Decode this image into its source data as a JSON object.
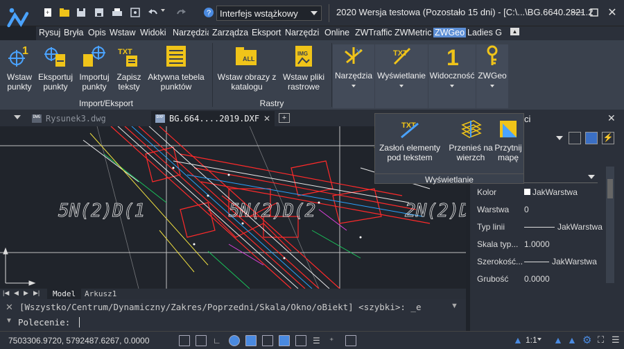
{
  "quick_access": {
    "icons": [
      "new-icon",
      "open-icon",
      "save-icon",
      "save-as-icon",
      "print-icon",
      "plot-preview-icon",
      "undo-icon",
      "redo-icon",
      "help-icon"
    ],
    "workspace": "Interfejs wstążkowy"
  },
  "title": "2020 Wersja testowa (Pozostało 15 dni) - [C:\\...\\BG.6640.2821.2",
  "menu": [
    "Rysuj",
    "Bryła",
    "Opis",
    "Wstaw",
    "Widoki",
    "Narzędzia",
    "Zarządzaj",
    "Eksport",
    "Narzędzia",
    "Online",
    "ZWTraffic",
    "ZWMetric",
    "ZWGeo",
    "Ladies Gr"
  ],
  "menu_active": "ZWGeo",
  "ribbon": {
    "import_export": {
      "label": "Import/Eksport",
      "buttons": [
        {
          "l1": "Wstaw",
          "l2": "punkty"
        },
        {
          "l1": "Eksportuj",
          "l2": "punkty"
        },
        {
          "l1": "Importuj",
          "l2": "punkty"
        },
        {
          "l1": "Zapisz",
          "l2": "teksty"
        },
        {
          "l1": "Aktywna tebela",
          "l2": "punktów"
        }
      ]
    },
    "rastry": {
      "label": "Rastry",
      "buttons": [
        {
          "l1": "Wstaw obrazy z",
          "l2": "katalogu"
        },
        {
          "l1": "Wstaw pliki",
          "l2": "rastrowe"
        }
      ]
    },
    "tools": [
      "Narzędzia",
      "Wyświetlanie",
      "Widoczność",
      "ZWGeo"
    ]
  },
  "popup": {
    "buttons": [
      {
        "l1": "Zasłoń elementy",
        "l2": "pod tekstem"
      },
      {
        "l1": "Przenieś na",
        "l2": "wierzch"
      },
      {
        "l1": "Przytnij",
        "l2": "mapę"
      }
    ],
    "label": "Wyświetlanie"
  },
  "doc_tabs": [
    "Rysunek3.dwg",
    "BG.664....2019.DXF"
  ],
  "drawing_texts": [
    "5N(2)D(1",
    "5N(2)D(2",
    "2N(2)D"
  ],
  "layout_tabs": [
    "Model",
    "Arkusz1"
  ],
  "command": {
    "history": "[Wszystko/Centrum/Dynamiczny/Zakres/Poprzedni/Skala/Okno/oBiekt] <szybki>: _e",
    "prompt": "Polecenie:"
  },
  "properties": {
    "title": "ci",
    "rows": [
      {
        "label": "Kolor",
        "value": "JakWarstwa"
      },
      {
        "label": "Warstwa",
        "value": "0"
      },
      {
        "label": "Typ linii",
        "value": "JakWarstwa"
      },
      {
        "label": "Skala typ...",
        "value": "1.0000"
      },
      {
        "label": "Szerokość...",
        "value": "JakWarstwa"
      },
      {
        "label": "Grubość",
        "value": "0.0000"
      }
    ]
  },
  "status": {
    "coords": "7503306.9720, 5792487.6267, 0.0000",
    "scale": "1:1"
  },
  "colors": {
    "accent": "#5d8fd6",
    "icon_yellow": "#f0c419",
    "ribbon": "#3a414d"
  }
}
